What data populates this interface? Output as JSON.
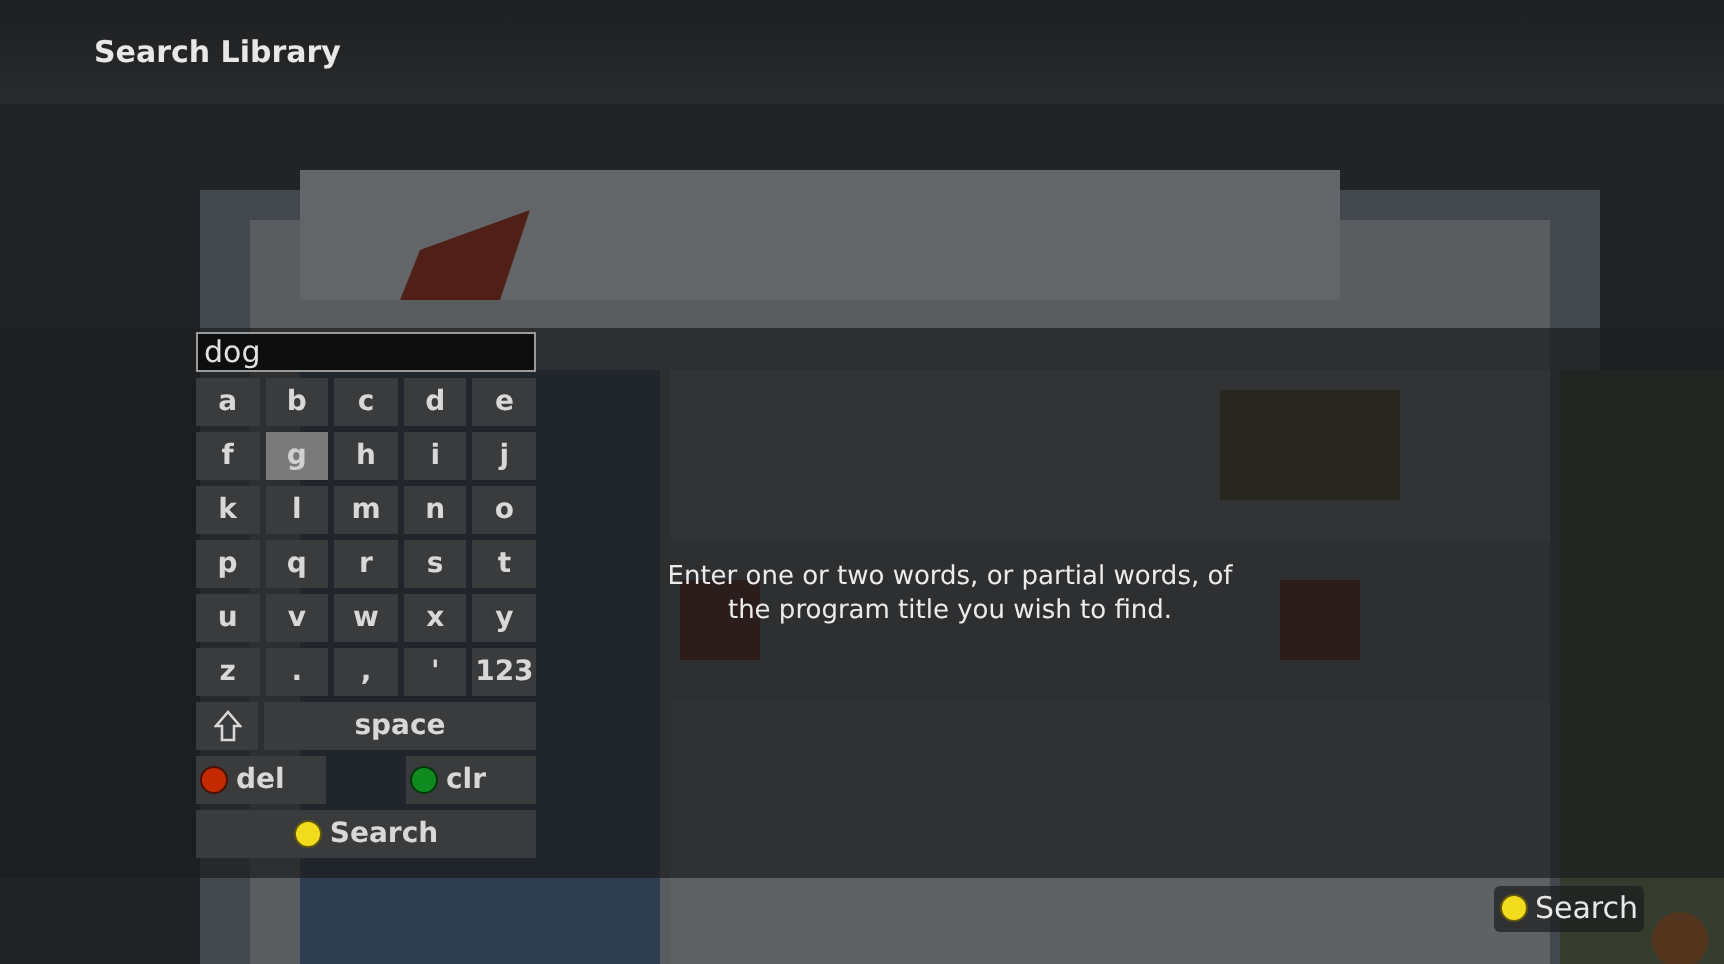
{
  "title": "Search Library",
  "search_field": {
    "value": "dog"
  },
  "keyboard": {
    "rows": [
      [
        {
          "label": "a",
          "selected": false
        },
        {
          "label": "b",
          "selected": false
        },
        {
          "label": "c",
          "selected": false
        },
        {
          "label": "d",
          "selected": false
        },
        {
          "label": "e",
          "selected": false
        }
      ],
      [
        {
          "label": "f",
          "selected": false
        },
        {
          "label": "g",
          "selected": true
        },
        {
          "label": "h",
          "selected": false
        },
        {
          "label": "i",
          "selected": false
        },
        {
          "label": "j",
          "selected": false
        }
      ],
      [
        {
          "label": "k",
          "selected": false
        },
        {
          "label": "l",
          "selected": false
        },
        {
          "label": "m",
          "selected": false
        },
        {
          "label": "n",
          "selected": false
        },
        {
          "label": "o",
          "selected": false
        }
      ],
      [
        {
          "label": "p",
          "selected": false
        },
        {
          "label": "q",
          "selected": false
        },
        {
          "label": "r",
          "selected": false
        },
        {
          "label": "s",
          "selected": false
        },
        {
          "label": "t",
          "selected": false
        }
      ],
      [
        {
          "label": "u",
          "selected": false
        },
        {
          "label": "v",
          "selected": false
        },
        {
          "label": "w",
          "selected": false
        },
        {
          "label": "x",
          "selected": false
        },
        {
          "label": "y",
          "selected": false
        }
      ],
      [
        {
          "label": "z",
          "selected": false
        },
        {
          "label": ".",
          "selected": false
        },
        {
          "label": ",",
          "selected": false
        },
        {
          "label": "'",
          "selected": false
        },
        {
          "label": "123",
          "selected": false
        }
      ]
    ]
  },
  "controls": [
    {
      "kind": "shift",
      "selected": false
    },
    {
      "kind": "space",
      "label": "space",
      "selected": false
    },
    {
      "kind": "action",
      "label": "del",
      "color": "#c42a00",
      "selected": false
    },
    {
      "kind": "action",
      "label": "clr",
      "color": "#0f8a1e",
      "selected": false
    },
    {
      "kind": "search",
      "label": "Search",
      "color": "#f2dc1e",
      "selected": false
    }
  ],
  "hint": "Enter one or two words, or partial words, of the program title you wish to find.",
  "footer_action": {
    "label": "Search",
    "color": "#f2dc1e"
  }
}
